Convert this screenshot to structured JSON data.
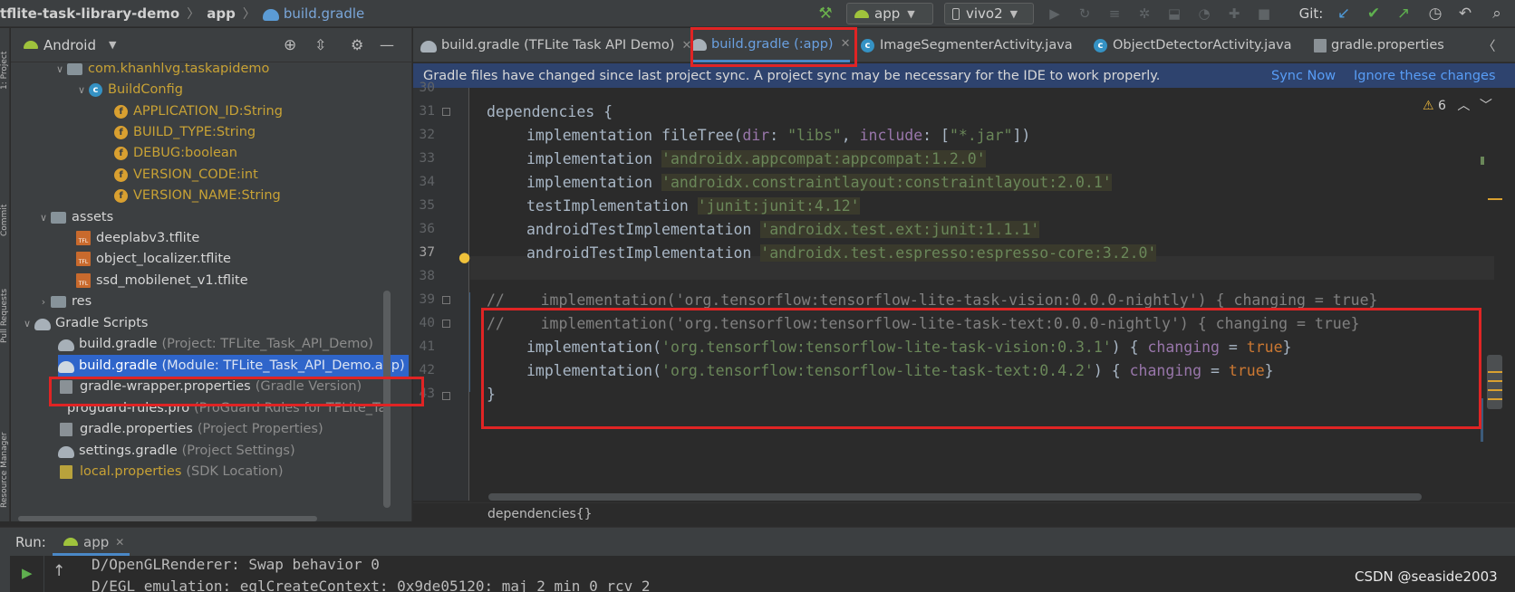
{
  "navbar": {
    "project": "tflite-task-library-demo",
    "module": "app",
    "file": "build.gradle",
    "run_config": "app",
    "device": "vivo2",
    "git_label": "Git:"
  },
  "left_strip": {
    "labels": [
      "1: Project",
      "Commit",
      "Pull Requests",
      "Resource Manager"
    ]
  },
  "project_panel": {
    "view": "Android",
    "rows": [
      {
        "text": "com.khanhlvg.taskapidemo",
        "hint": ""
      },
      {
        "text": "BuildConfig",
        "hint": ""
      },
      {
        "text": "APPLICATION_ID:String",
        "hint": ""
      },
      {
        "text": "BUILD_TYPE:String",
        "hint": ""
      },
      {
        "text": "DEBUG:boolean",
        "hint": ""
      },
      {
        "text": "VERSION_CODE:int",
        "hint": ""
      },
      {
        "text": "VERSION_NAME:String",
        "hint": ""
      },
      {
        "text": "assets",
        "hint": ""
      },
      {
        "text": "deeplabv3.tflite",
        "hint": ""
      },
      {
        "text": "object_localizer.tflite",
        "hint": ""
      },
      {
        "text": "ssd_mobilenet_v1.tflite",
        "hint": ""
      },
      {
        "text": "res",
        "hint": ""
      },
      {
        "text": "Gradle Scripts",
        "hint": ""
      },
      {
        "text": "build.gradle",
        "hint": "(Project: TFLite_Task_API_Demo)"
      },
      {
        "text": "build.gradle",
        "hint": "(Module: TFLite_Task_API_Demo.app)"
      },
      {
        "text": "gradle-wrapper.properties",
        "hint": "(Gradle Version)"
      },
      {
        "text": "proguard-rules.pro",
        "hint": "(ProGuard Rules for TFLite_Task_AP"
      },
      {
        "text": "gradle.properties",
        "hint": "(Project Properties)"
      },
      {
        "text": "settings.gradle",
        "hint": "(Project Settings)"
      },
      {
        "text": "local.properties",
        "hint": "(SDK Location)"
      }
    ]
  },
  "tabs": [
    {
      "label": "build.gradle (TFLite Task API Demo)"
    },
    {
      "label": "build.gradle (:app)"
    },
    {
      "label": "ImageSegmenterActivity.java"
    },
    {
      "label": "ObjectDetectorActivity.java"
    },
    {
      "label": "gradle.properties"
    }
  ],
  "notification": {
    "message": "Gradle files have changed since last project sync. A project sync may be necessary for the IDE to work properly.",
    "sync_now": "Sync Now",
    "ignore": "Ignore these changes"
  },
  "editor": {
    "warnings": "6",
    "line_numbers": [
      "30",
      "31",
      "32",
      "33",
      "34",
      "35",
      "36",
      "37",
      "38",
      "39",
      "40",
      "41",
      "42",
      "43"
    ],
    "current_line": "37",
    "lines": {
      "l31": "dependencies {",
      "l32_a": "implementation ",
      "l32_b": "fileTree(",
      "l32_c": "dir",
      "l32_d": ": ",
      "l32_e": "\"libs\"",
      "l32_f": ", ",
      "l32_g": "include",
      "l32_h": ": [",
      "l32_i": "\"*.jar\"",
      "l32_j": "])",
      "l33_a": "implementation ",
      "l33_b": "'androidx.appcompat:appcompat:1.2.0'",
      "l34_a": "implementation ",
      "l34_b": "'androidx.constraintlayout:constraintlayout:2.0.1'",
      "l35_a": "testImplementation ",
      "l35_b": "'junit:junit:4.12'",
      "l36_a": "androidTestImplementation ",
      "l36_b": "'androidx.test.ext:junit:1.1.1'",
      "l37_a": "androidTestImplementation ",
      "l37_b": "'androidx.test.espresso:espresso-core:3.2.0'",
      "l39": "//    implementation('org.tensorflow:tensorflow-lite-task-vision:0.0.0-nightly') { changing = true}",
      "l40": "//    implementation('org.tensorflow:tensorflow-lite-task-text:0.0.0-nightly') { changing = true}",
      "l41_a": "implementation(",
      "l41_b": "'org.tensorflow:tensorflow-lite-task-vision:0.3.1'",
      "l41_c": ") { ",
      "l41_d": "changing",
      "l41_e": " = ",
      "l41_f": "true",
      "l41_g": "}",
      "l42_a": "implementation(",
      "l42_b": "'org.tensorflow:tensorflow-lite-task-text:0.4.2'",
      "l42_c": ") { ",
      "l42_d": "changing",
      "l42_e": " = ",
      "l42_f": "true",
      "l42_g": "}",
      "l43": "}"
    },
    "breadcrumb": "dependencies{}"
  },
  "run_panel": {
    "label": "Run:",
    "tab": "app",
    "console_lines": [
      "D/OpenGLRenderer: Swap behavior 0",
      "D/EGL_emulation: eglCreateContext: 0x9de05120: maj 2 min 0 rcv 2"
    ]
  },
  "watermark": "CSDN @seaside2003",
  "colors": {
    "annotation": "#e02424",
    "editor_bg": "#2b2b2b",
    "panel_bg": "#3c3f41",
    "notification_bg": "#2e436e"
  }
}
